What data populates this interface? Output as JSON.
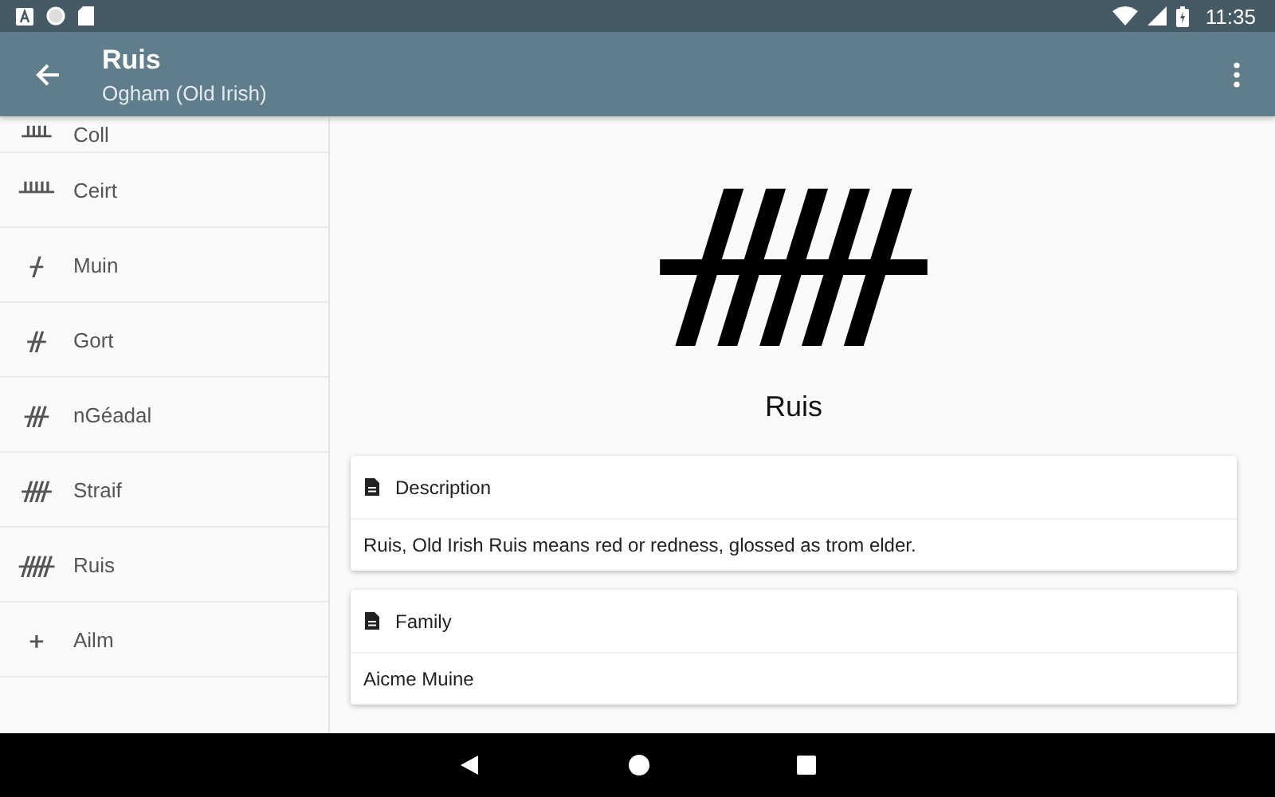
{
  "status_bar": {
    "time": "11:35"
  },
  "app_bar": {
    "title": "Ruis",
    "subtitle": "Ogham (Old Irish)"
  },
  "letters": [
    {
      "glyph": "ᚉ",
      "name": "Coll",
      "selected": false,
      "kind": "partial"
    },
    {
      "glyph": "ᚊ",
      "name": "Ceirt",
      "selected": false,
      "kind": "full"
    },
    {
      "glyph": "ᚋ",
      "name": "Muin",
      "selected": false,
      "kind": "full"
    },
    {
      "glyph": "ᚌ",
      "name": "Gort",
      "selected": false,
      "kind": "full"
    },
    {
      "glyph": "ᚍ",
      "name": "nGéadal",
      "selected": false,
      "kind": "full"
    },
    {
      "glyph": "ᚎ",
      "name": "Straif",
      "selected": false,
      "kind": "full"
    },
    {
      "glyph": "ᚏ",
      "name": "Ruis",
      "selected": false,
      "kind": "full"
    },
    {
      "glyph": "ᚐ",
      "name": "Ailm",
      "selected": false,
      "kind": "full"
    }
  ],
  "detail": {
    "glyph": "ᚏ",
    "name": "Ruis",
    "cards": [
      {
        "title": "Description",
        "body": "Ruis, Old Irish Ruis means red or redness, glossed as trom elder."
      },
      {
        "title": "Family",
        "body": "Aicme Muine"
      }
    ]
  }
}
